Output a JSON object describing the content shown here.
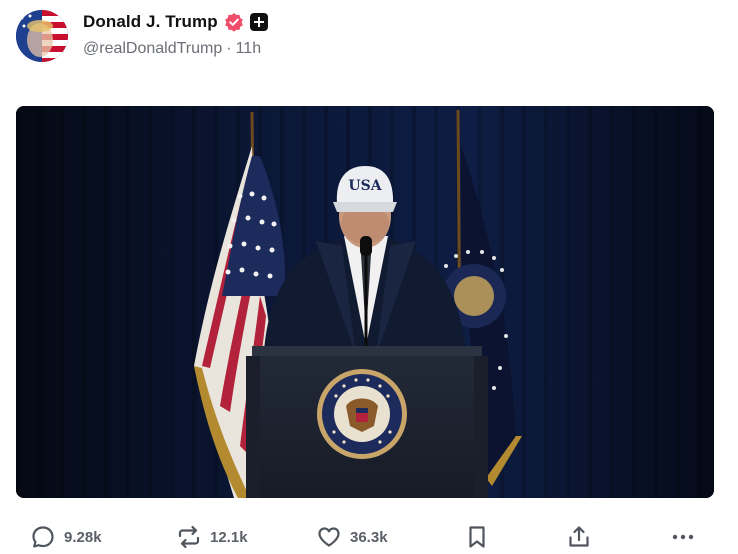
{
  "post": {
    "author": {
      "display_name": "Donald J. Trump",
      "handle": "@realDonaldTrump",
      "separator": "·",
      "time_ago": "11h",
      "verified_icon": "verified-badge-icon",
      "plus_icon": "plus-badge-icon",
      "accent_color": "#ef4d6a"
    },
    "media": {
      "type": "photo",
      "cap_text": "USA"
    },
    "actions": {
      "replies": "9.28k",
      "reposts": "12.1k",
      "likes": "36.3k",
      "icons": [
        "comment-icon",
        "repost-icon",
        "heart-icon",
        "bookmark-icon",
        "share-icon",
        "more-icon"
      ]
    }
  }
}
